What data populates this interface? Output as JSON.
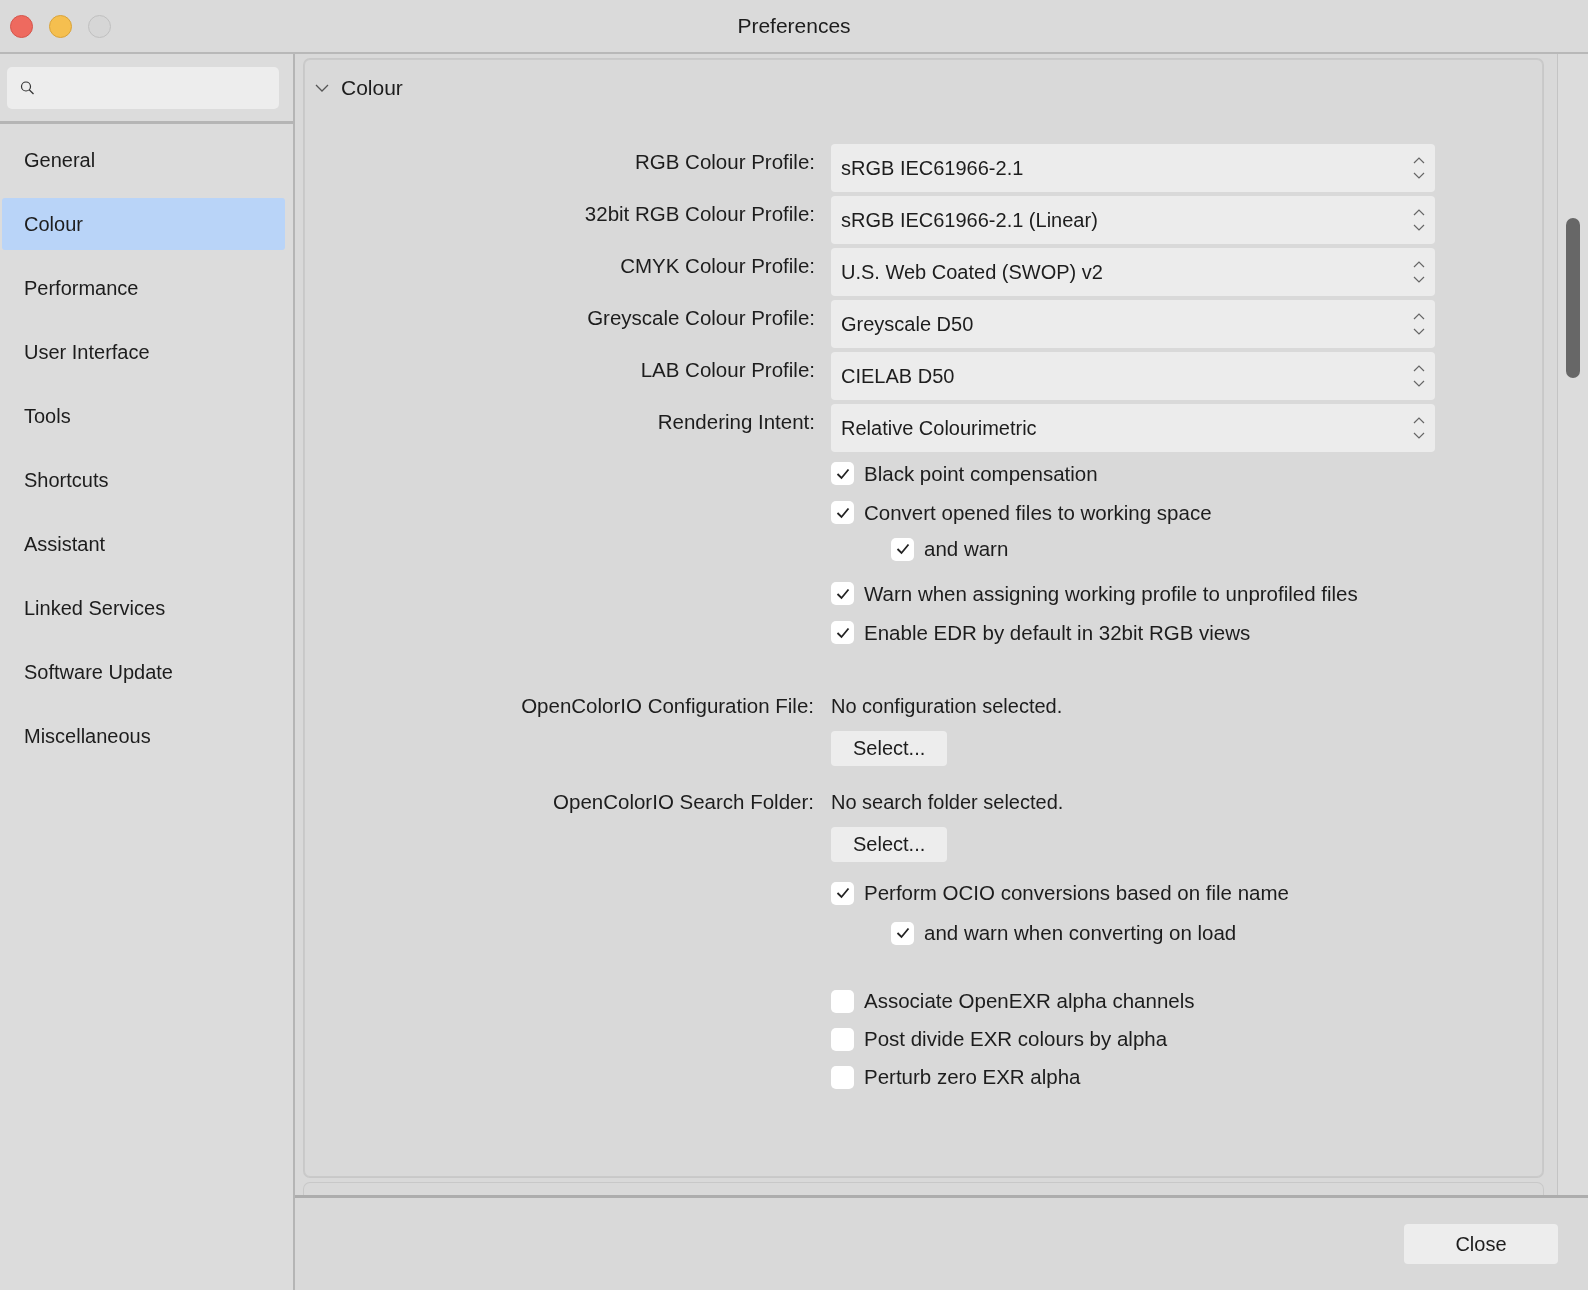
{
  "window": {
    "title": "Preferences"
  },
  "sidebar": {
    "items": [
      {
        "label": "General",
        "selected": false
      },
      {
        "label": "Colour",
        "selected": true
      },
      {
        "label": "Performance",
        "selected": false
      },
      {
        "label": "User Interface",
        "selected": false
      },
      {
        "label": "Tools",
        "selected": false
      },
      {
        "label": "Shortcuts",
        "selected": false
      },
      {
        "label": "Assistant",
        "selected": false
      },
      {
        "label": "Linked Services",
        "selected": false
      },
      {
        "label": "Software Update",
        "selected": false
      },
      {
        "label": "Miscellaneous",
        "selected": false
      }
    ]
  },
  "section": {
    "title": "Colour",
    "expanded": true,
    "profiles": [
      {
        "label": "RGB Colour Profile:",
        "value": "sRGB IEC61966-2.1"
      },
      {
        "label": "32bit RGB Colour Profile:",
        "value": "sRGB IEC61966-2.1 (Linear)"
      },
      {
        "label": "CMYK Colour Profile:",
        "value": "U.S. Web Coated (SWOP) v2"
      },
      {
        "label": "Greyscale Colour Profile:",
        "value": "Greyscale D50"
      },
      {
        "label": "LAB Colour Profile:",
        "value": "CIELAB D50"
      },
      {
        "label": "Rendering Intent:",
        "value": "Relative Colourimetric"
      }
    ],
    "options": [
      {
        "label": "Black point compensation",
        "checked": true
      },
      {
        "label": "Convert opened files to working space",
        "checked": true,
        "children": [
          {
            "label": "and warn",
            "checked": true
          }
        ]
      },
      {
        "label": "Warn when assigning working profile to unprofiled files",
        "checked": true
      },
      {
        "label": "Enable EDR by default in 32bit RGB views",
        "checked": true
      }
    ],
    "ocio": [
      {
        "label": "OpenColorIO Configuration File:",
        "value": "No configuration selected.",
        "button": "Select..."
      },
      {
        "label": "OpenColorIO Search Folder:",
        "value": "No search folder selected.",
        "button": "Select..."
      }
    ],
    "ocio_options": [
      {
        "label": "Perform OCIO conversions based on file name",
        "checked": true,
        "children": [
          {
            "label": "and warn when converting on load",
            "checked": true
          }
        ]
      }
    ],
    "exr_options": [
      {
        "label": "Associate OpenEXR alpha channels",
        "checked": false
      },
      {
        "label": "Post divide EXR colours by alpha",
        "checked": false
      },
      {
        "label": "Perturb zero EXR alpha",
        "checked": false
      }
    ]
  },
  "footer": {
    "button": "Close"
  }
}
